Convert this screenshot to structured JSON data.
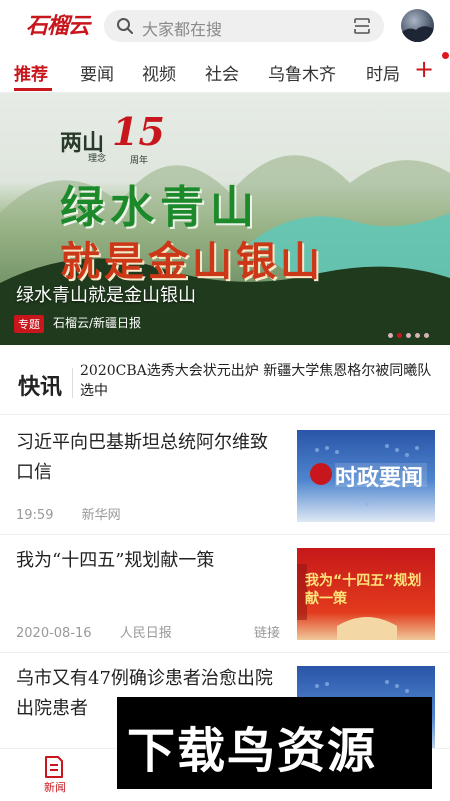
{
  "header": {
    "logo_text": "石榴云",
    "search_placeholder": "大家都在搜",
    "accent_color": "#c8161d"
  },
  "tabs": [
    {
      "label": "推荐",
      "active": true
    },
    {
      "label": "要闻",
      "active": false
    },
    {
      "label": "视频",
      "active": false
    },
    {
      "label": "社会",
      "active": false
    },
    {
      "label": "乌鲁木齐",
      "active": false
    },
    {
      "label": "时局",
      "active": false
    }
  ],
  "tabs_add_label": "+",
  "banner": {
    "badge_line1": "两山",
    "badge_line2": "理念",
    "badge_number": "15",
    "badge_suffix": "周年",
    "calligraphy_line1": "绿水青山",
    "calligraphy_line2": "就是金山银山",
    "title": "绿水青山就是金山银山",
    "tag": "专题",
    "source": "石榴云/新疆日报",
    "page_count": 5,
    "active_page": 1
  },
  "flash": {
    "label": "快讯",
    "text": "2020CBA选秀大会状元出炉 新疆大学焦恩格尔被同曦队选中"
  },
  "news": [
    {
      "title": "习近平向巴基斯坦总统阿尔维致口信",
      "time": "19:59",
      "source": "新华网",
      "link": "",
      "thumb_text": "时政要闻"
    },
    {
      "title": "我为“十四五”规划献一策",
      "time": "2020-08-16",
      "source": "人民日报",
      "link": "链接",
      "thumb_text": "我为“十四五”规划献一策"
    },
    {
      "title": "乌市又有47例确诊患者治愈出院 出院患者",
      "time": "",
      "source": "",
      "link": "",
      "thumb_text": ""
    }
  ],
  "bottom_nav": [
    {
      "label": "新闻",
      "active": true,
      "icon": "news-icon"
    },
    {
      "label": "",
      "active": false,
      "icon": ""
    },
    {
      "label": "",
      "active": false,
      "icon": ""
    },
    {
      "label": "",
      "active": false,
      "icon": ""
    }
  ],
  "watermark": "下载鸟资源"
}
